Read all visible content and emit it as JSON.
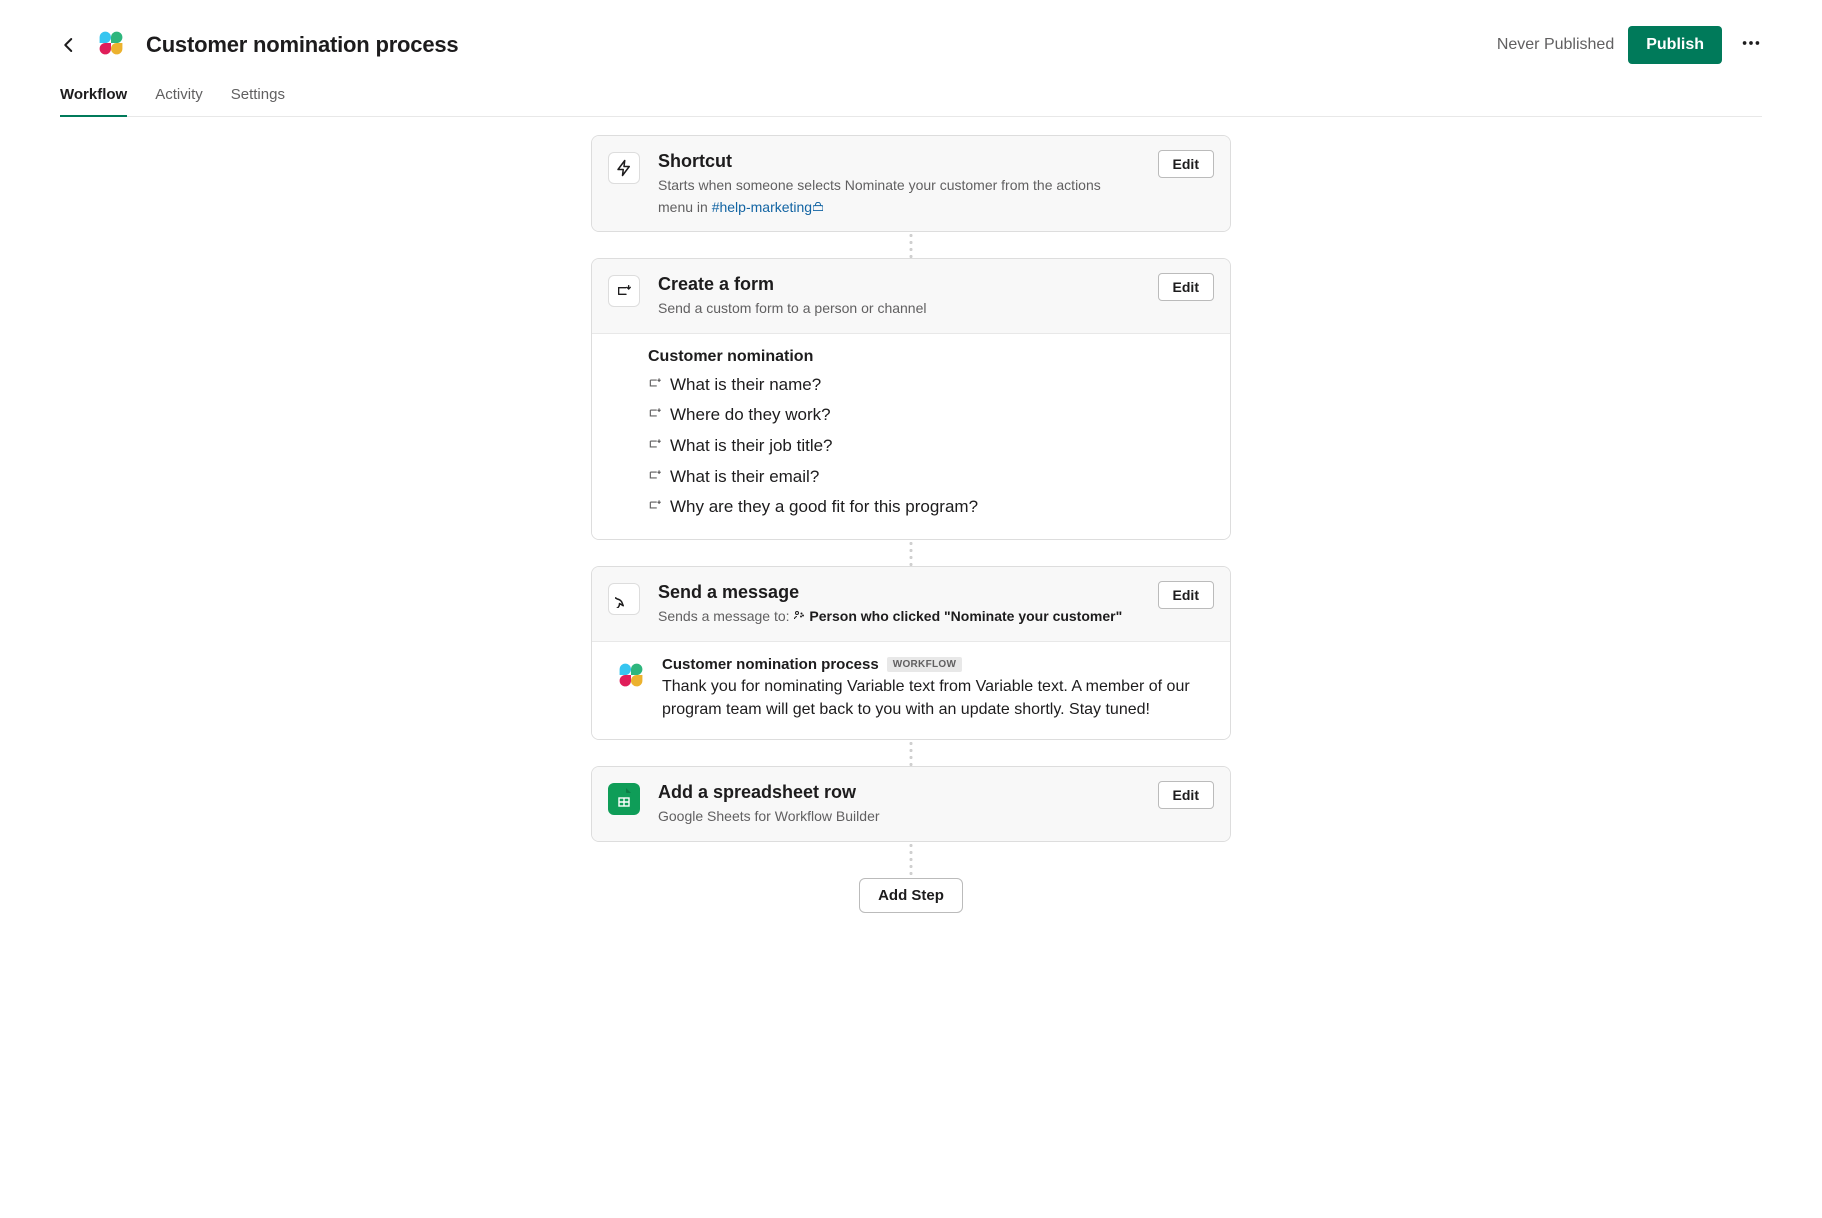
{
  "header": {
    "title": "Customer nomination process",
    "status": "Never Published",
    "publish": "Publish"
  },
  "tabs": {
    "workflow": "Workflow",
    "activity": "Activity",
    "settings": "Settings"
  },
  "steps": {
    "shortcut": {
      "title": "Shortcut",
      "desc_a": "Starts when someone selects Nominate your customer from the actions menu in ",
      "channel": "#help-marketing",
      "edit": "Edit"
    },
    "form": {
      "title": "Create a form",
      "desc": "Send a custom form to a person or channel",
      "edit": "Edit",
      "form_title": "Customer nomination",
      "q1": "What is their name?",
      "q2": "Where do they work?",
      "q3": "What is their job title?",
      "q4": "What is their email?",
      "q5": "Why are they a good fit for this program?"
    },
    "message": {
      "title": "Send a message",
      "desc_prefix": "Sends a message to: ",
      "recipient": "Person who clicked \"Nominate your customer\"",
      "edit": "Edit",
      "sender": "Customer nomination process",
      "badge": "WORKFLOW",
      "body": "Thank you for nominating Variable text from Variable text. A member of our program team will get back to you with an update shortly. Stay tuned!"
    },
    "sheets": {
      "title": "Add a spreadsheet row",
      "desc": "Google Sheets for Workflow Builder",
      "edit": "Edit"
    }
  },
  "add_step": "Add Step"
}
